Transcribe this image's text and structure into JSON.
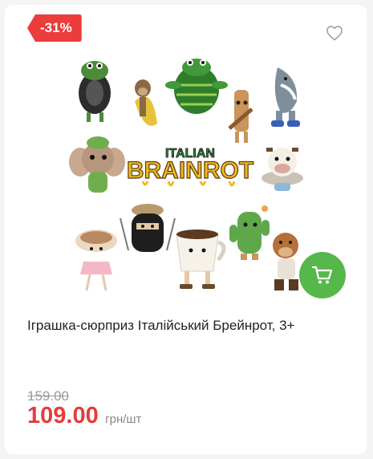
{
  "product": {
    "discount_label": "-31%",
    "title": "Іграшка-сюрприз Італійський Брейнрот, 3+",
    "old_price": "159.00",
    "price": "109.00",
    "unit": "грн/шт",
    "image": {
      "logo_top": "ITALIAN",
      "logo_main": "BRAINROT"
    }
  },
  "icons": {
    "favorite": "heart-outline-icon",
    "cart": "shopping-cart-icon"
  },
  "colors": {
    "discount_bg": "#ec3c3c",
    "price": "#e53c3c",
    "cart_button": "#56b84a"
  }
}
